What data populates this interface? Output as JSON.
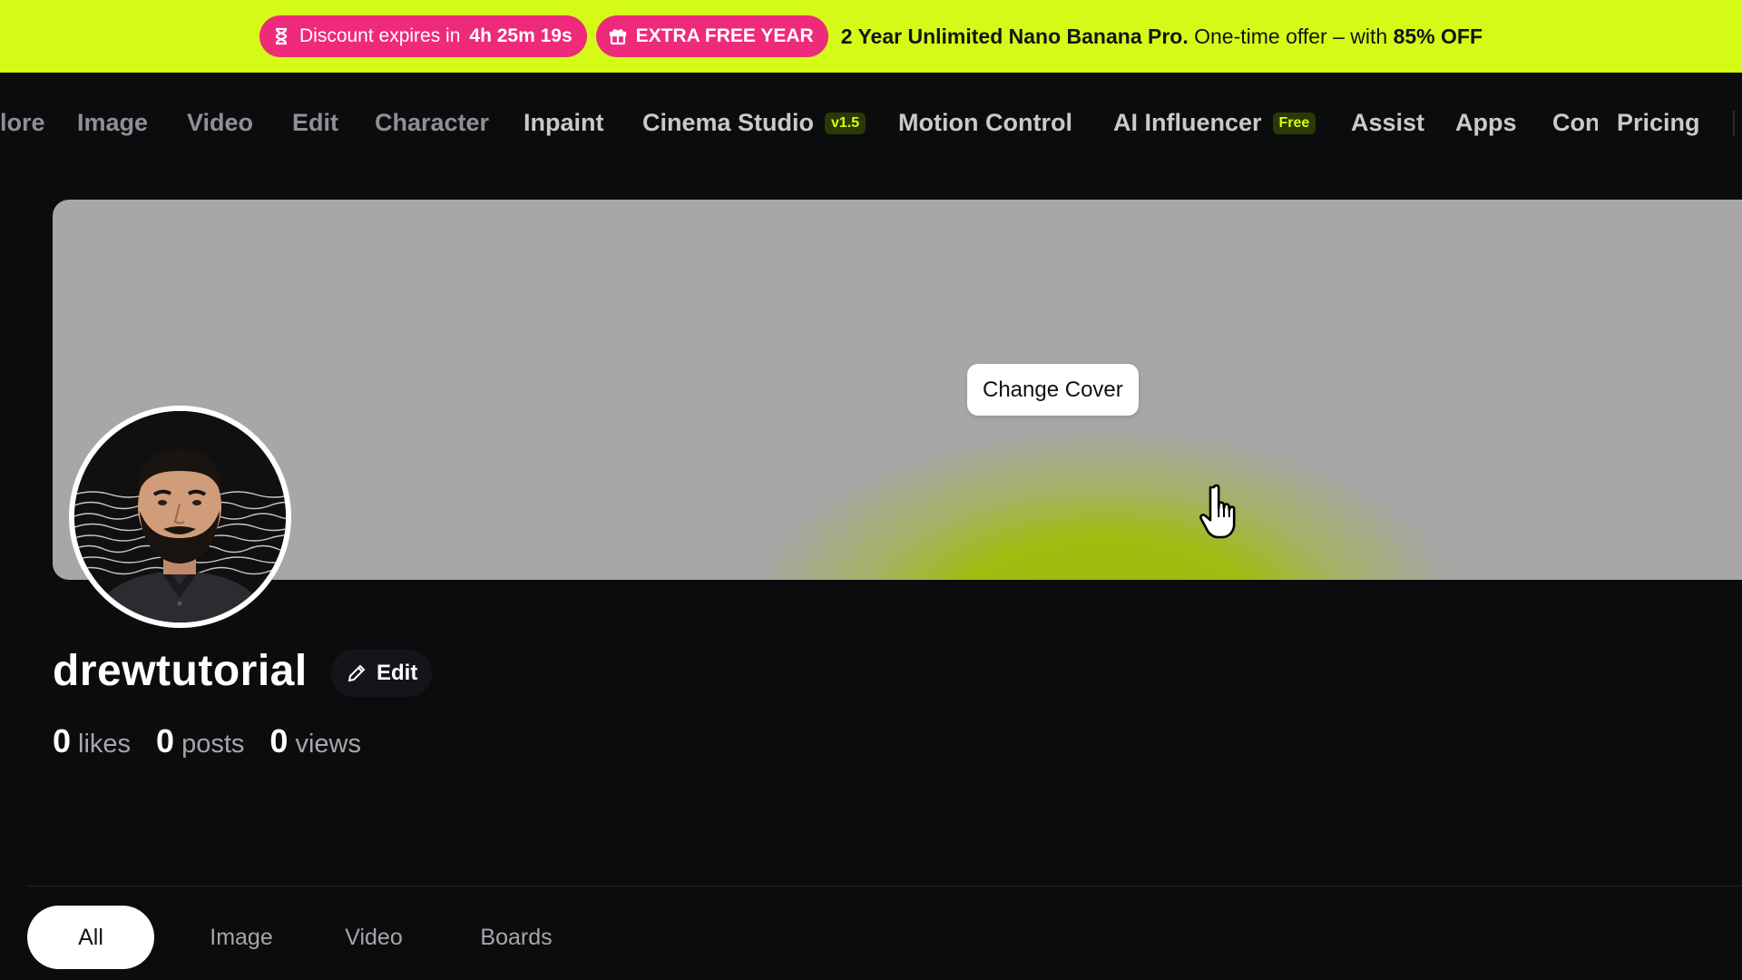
{
  "promo": {
    "timer_prefix": "Discount expires in",
    "timer_value": "4h 25m 19s",
    "extra_label": "EXTRA FREE YEAR",
    "headline": "2 Year Unlimited Nano Banana Pro.",
    "offer_text": "One-time offer – with",
    "offer_value": "85% OFF",
    "accent_color": "#d4fb17",
    "pill_color": "#ee2a7b"
  },
  "nav": {
    "items": [
      {
        "label": "lore"
      },
      {
        "label": "Image"
      },
      {
        "label": "Video"
      },
      {
        "label": "Edit"
      },
      {
        "label": "Character"
      },
      {
        "label": "Inpaint"
      },
      {
        "label": "Cinema Studio",
        "badge": "v1.5"
      },
      {
        "label": "Motion Control"
      },
      {
        "label": "AI Influencer",
        "badge": "Free"
      },
      {
        "label": "Assist"
      },
      {
        "label": "Apps"
      },
      {
        "label": "Con"
      },
      {
        "label": "Pricing"
      }
    ]
  },
  "cover": {
    "change_label": "Change Cover",
    "bg_color": "#a7a7a7"
  },
  "profile": {
    "username": "drewtutorial",
    "edit_label": "Edit",
    "stats": [
      {
        "num": "0",
        "label": "likes"
      },
      {
        "num": "0",
        "label": "posts"
      },
      {
        "num": "0",
        "label": "views"
      }
    ]
  },
  "tabs": [
    {
      "label": "All"
    },
    {
      "label": "Image"
    },
    {
      "label": "Video"
    },
    {
      "label": "Boards"
    }
  ]
}
